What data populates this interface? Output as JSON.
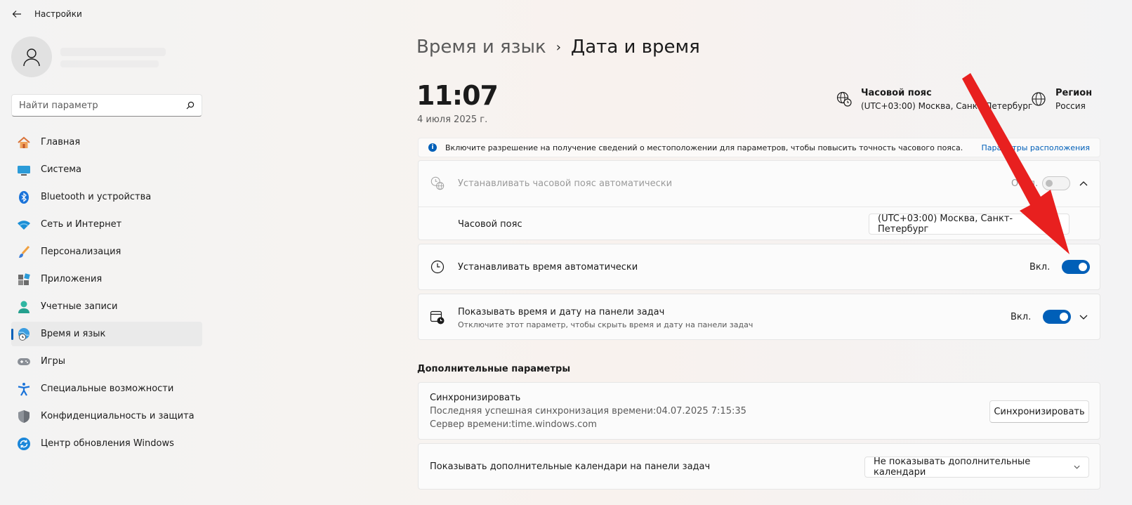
{
  "window": {
    "title": "Настройки"
  },
  "search": {
    "placeholder": "Найти параметр"
  },
  "sidebar": {
    "items": [
      {
        "label": "Главная",
        "icon": "home-icon"
      },
      {
        "label": "Система",
        "icon": "system-icon"
      },
      {
        "label": "Bluetooth и устройства",
        "icon": "bluetooth-icon"
      },
      {
        "label": "Сеть и Интернет",
        "icon": "wifi-icon"
      },
      {
        "label": "Персонализация",
        "icon": "brush-icon"
      },
      {
        "label": "Приложения",
        "icon": "apps-icon"
      },
      {
        "label": "Учетные записи",
        "icon": "account-icon"
      },
      {
        "label": "Время и язык",
        "icon": "time-language-icon",
        "active": true
      },
      {
        "label": "Игры",
        "icon": "gamepad-icon"
      },
      {
        "label": "Специальные возможности",
        "icon": "accessibility-icon"
      },
      {
        "label": "Конфиденциальность и защита",
        "icon": "shield-icon"
      },
      {
        "label": "Центр обновления Windows",
        "icon": "update-icon"
      }
    ]
  },
  "breadcrumb": {
    "parent": "Время и язык",
    "separator": "›",
    "current": "Дата и время"
  },
  "clock": {
    "time": "11:07",
    "date": "4 июля 2025 г."
  },
  "timezone_info": {
    "title": "Часовой пояс",
    "value": "(UTC+03:00) Москва, Санкт-Петербург"
  },
  "region_info": {
    "title": "Регион",
    "value": "Россия"
  },
  "banner": {
    "text": "Включите разрешение на получение сведений о местоположении для параметров, чтобы повысить точность часового пояса.",
    "link": "Параметры расположения"
  },
  "auto_timezone": {
    "label": "Устанавливать часовой пояс автоматически",
    "state": "Откл."
  },
  "timezone_row": {
    "label": "Часовой пояс",
    "value": "(UTC+03:00) Москва, Санкт-Петербург"
  },
  "auto_time": {
    "label": "Устанавливать время автоматически",
    "state": "Вкл."
  },
  "taskbar_time": {
    "label": "Показывать время и дату на панели задач",
    "sub": "Отключите этот параметр, чтобы скрыть время и дату на панели задач",
    "state": "Вкл."
  },
  "additional": {
    "title": "Дополнительные параметры"
  },
  "sync": {
    "title": "Синхронизировать",
    "last": "Последняя успешная синхронизация времени:04.07.2025 7:15:35",
    "server": "Сервер времени:time.windows.com",
    "button": "Синхронизировать"
  },
  "calendars": {
    "label": "Показывать дополнительные календари на панели задач",
    "value": "Не показывать дополнительные календари"
  },
  "colors": {
    "accent": "#005fb8",
    "annotation_arrow": "#e8201f"
  }
}
